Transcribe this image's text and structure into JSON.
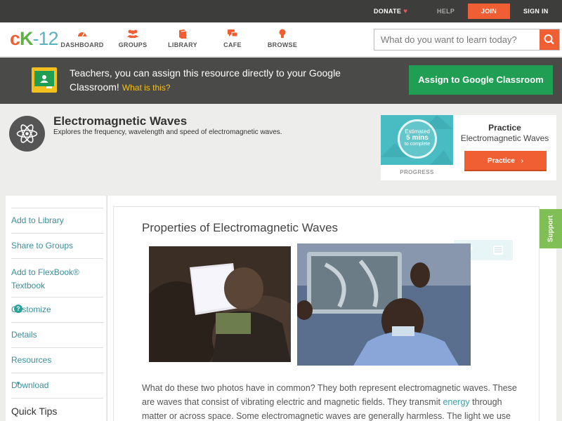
{
  "topbar": {
    "donate": "DONATE",
    "help": "HELP",
    "join": "JOIN",
    "sign_in": "SIGN IN"
  },
  "logo": {
    "c": "c",
    "k": "K",
    "rest": "-12"
  },
  "nav": {
    "items": [
      {
        "label": "DASHBOARD",
        "icon": "dashboard-gauge-icon"
      },
      {
        "label": "GROUPS",
        "icon": "groups-people-icon"
      },
      {
        "label": "LIBRARY",
        "icon": "library-book-icon"
      },
      {
        "label": "CAFE",
        "icon": "cafe-chat-icon"
      },
      {
        "label": "BROWSE",
        "icon": "browse-bulb-icon"
      }
    ]
  },
  "search": {
    "placeholder": "What do you want to learn today?",
    "value": ""
  },
  "classroom": {
    "message": "Teachers, you can assign this resource directly to your Google Classroom!",
    "what_is": "What is this?",
    "assign_label": "Assign to Google Classroom"
  },
  "concept": {
    "title": "Electromagnetic Waves",
    "description": "Explores the frequency, wavelength and speed of electromagnetic waves."
  },
  "practice": {
    "estimate_line1": "Estimated",
    "estimate_line2": "5 mins",
    "estimate_line3": "to complete",
    "progress_label": "PROGRESS",
    "label": "Practice",
    "subject": "Electromagnetic Waves",
    "button": "Practice"
  },
  "sidebar": {
    "items": [
      {
        "label": "Add to Library"
      },
      {
        "label": "Share to Groups"
      },
      {
        "label": "Add to FlexBook® Textbook"
      },
      {
        "label": "Customize"
      },
      {
        "label": "Details"
      },
      {
        "label": "Resources"
      },
      {
        "label": "Download"
      }
    ],
    "quick_tips": "Quick Tips"
  },
  "article": {
    "title": "Properties of Electromagnetic Waves",
    "body_1": "What do these two photos have in common? They both represent electromagnetic waves. These are waves that consist of vibrating electric and magnetic fields. They transmit ",
    "body_link": "energy",
    "body_2": " through matter or across space. Some electromagnetic waves are generally harmless. The light we use"
  },
  "support": "Support",
  "colors": {
    "accent_orange": "#ef5f33",
    "teal": "#48bcc2",
    "classroom_green": "#1f9e54",
    "support_green": "#7fbf55"
  }
}
